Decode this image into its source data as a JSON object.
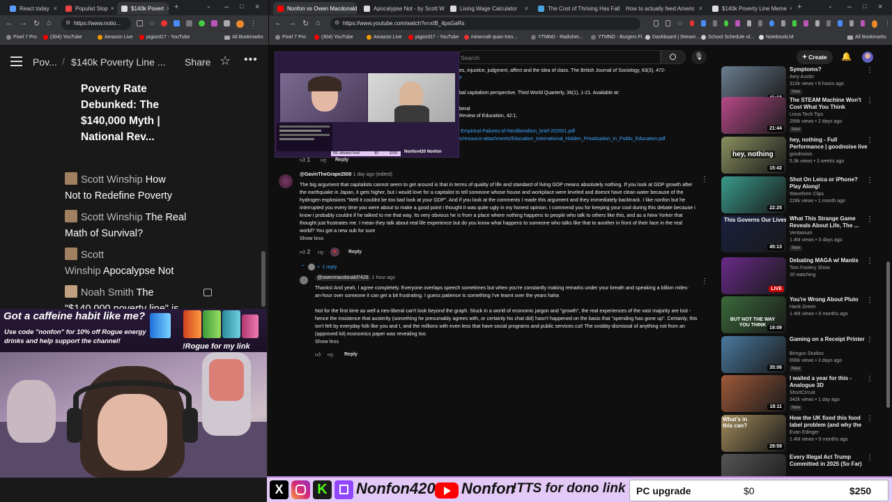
{
  "left_browser": {
    "tabs": [
      {
        "label": "React today",
        "color": "#5a9cff"
      },
      {
        "label": "Populist Slop",
        "color": "#e44"
      },
      {
        "label": "$140k Povert",
        "color": "#ddd"
      }
    ],
    "url": "https://www.notio...",
    "bookmarks": [
      "Pixel 7 Pro",
      "(304) YouTube",
      "Amazon Live",
      "pigiord17 - YouTube"
    ],
    "bookmarks_folder": "All Bookmarks",
    "header": {
      "crumb1": "Pov...",
      "crumb2": "$140k Poverty Line ...",
      "share": "Share"
    },
    "article_title": [
      "Poverty Rate",
      "Debunked: The",
      "$140,000 Myth |",
      "National Rev..."
    ],
    "items": [
      {
        "author": "Scott Winship",
        "title1": "How",
        "title2": "Not to Redefine Poverty"
      },
      {
        "author": "Scott Winship",
        "title1": "The Real",
        "title2": "Math of Survival?"
      },
      {
        "author": "Scott",
        "author2": "Winship",
        "title1": "Apocalypse Not"
      },
      {
        "author": "Noah Smith",
        "title1": "The",
        "title2": "\"$140,000 poverty line\" is"
      }
    ]
  },
  "right_browser": {
    "tabs": [
      {
        "label": "Nonfon vs Owen Macdonald",
        "color": "#f00"
      },
      {
        "label": "Apocalypse Not - by Scott W",
        "color": "#ddd"
      },
      {
        "label": "Living Wage Calculator",
        "color": "#ddd"
      },
      {
        "label": "The Cost of Thriving Has Fall",
        "color": "#4aa3df"
      },
      {
        "label": "How to actually feed Americ",
        "color": "#ddd"
      },
      {
        "label": "$140k Poverty Line Meme",
        "color": "#ddd"
      }
    ],
    "url": "https://www.youtube.com/watch?v=xIB_4psGaRs",
    "bookmarks": [
      "Pixel 7 Pro",
      "(304) YouTube",
      "Amazon Live",
      "pigiord17 - YouTube",
      "minecraft quan tron...",
      "YTMND - Radisher...",
      "YTMND - Burgers Fl...",
      "Dashboard | Stream...",
      "School Schedule of...",
      "NotebookLM"
    ],
    "bookmarks_folder": "All Bookmarks"
  },
  "youtube": {
    "search_placeholder": "Search",
    "create_label": "Create",
    "refs": [
      "es, injustice, judgment, affect and the idea of class. The British Journal of Sociology, 63(3), 472-",
      "bal capitalism perspective. Third World Quarterly, 36(1), 1-21. Available at:",
      "beral",
      "Review of Education, 42:1,",
      "-Empirical-Failures-of-Neoliberalism_brief-202001.pdf",
      "s/resource-attachments/Education_International_Hidden_Privatisation_in_Public_Education.pdf"
    ],
    "top_likes": "1",
    "reply_label": "Reply",
    "comment1": {
      "author": "@GavinTheGrape2500",
      "time": "1 day ago (edited)",
      "text": "The big argument that capitalists cannot seem to get around is that in terms of quality of life and standard of living GDP means absolutely nothing. If you look at GDP growth after the earthquake in Japan, it gets higher, but i would love for a capitalist to tell someone whose house and workplace were leveled and doesnt have clean water because of the hydrogen explosions \"Well it couldnt be too bad look at your GDP\". And if you look at the comments I made this argument and they immediately backtrack. I like nonfon but he interrupted you every time you were about to make a good point i thought it was quite ugly in my honest opinion. I commend you for keeping your cool during this debate because i know i probably couldnt if he talked to me that way. Its very obvious he is from a place where nothing happens to people who talk to others like this, and as a New Yorker that thought just frustrates me. I mean they talk about real life experience but do you know what happens to someone who talks like that to another in front of their face in the real world? You got a new sub for sure",
      "show_less": "Show less",
      "likes": "2",
      "replies": "1 reply"
    },
    "reply1": {
      "author": "@owenmacdonald7428",
      "time": "1 hour ago",
      "text1": "Thanks! And yeah, I agree completely. Everyone overlaps speech sometimes but when you're constantly making remarks under your breath and speaking a billion miles-an-hour over someone it can get a bit frustrating. I guess patience is something I've learnt over the years haha",
      "text2": "Not for the first time as well a neo-liberal can't look beyond the graph. Stuck in a world of economic jargon and \"growth\", the real experiences of the vast majority are lost - hence the insistence that austerity (something he presumably agrees with, or certainly his chat did) hasn't happened on the basis that \"spending has gone up\". Certainly, this isn't felt by everyday folk like you and I, and the millions with even less that have social programs and public services cut! The snobby dismissal of anything not from an (approved lol) economics paper was revealing too.",
      "show_less": "Show less"
    },
    "sidebar": [
      {
        "title": "Symptoms?",
        "channel": "Amy Austin",
        "meta": "310k views • 6 hours ago",
        "new": "New",
        "dur": "41:18",
        "color": "#6a7d8f"
      },
      {
        "title": "The STEAM Machine Won't Cost What You Think",
        "channel": "Linus Tech Tips",
        "meta": "299k views • 2 days ago",
        "new": "New",
        "dur": "21:44",
        "color": "#b84a8a"
      },
      {
        "title": "hey, nothing - Full Performance | goodnoise live",
        "channel": "goodnoise.",
        "meta": "5.3k views • 3 weeks ago",
        "new": "",
        "dur": "15:42",
        "color": "#8a8f60"
      },
      {
        "title": "Shot On Leica or iPhone? Play Along!",
        "channel": "Waveform Clips",
        "meta": "226k views • 1 month ago",
        "new": "",
        "dur": "22:25",
        "color": "#3a9a8a"
      },
      {
        "title": "What This Strange Game Reveals About Life, The ...",
        "channel": "Veritasium",
        "meta": "1.4M views • 3 days ago",
        "new": "New",
        "dur": "45:13",
        "color": "#1a2040"
      },
      {
        "title": "Debating MAGA w/ Mantis",
        "channel": "Tom Foolery Show",
        "meta": "20 watching",
        "new": "",
        "dur": "LIVE",
        "color": "#6a2a8a"
      },
      {
        "title": "You're Wrong About Pluto",
        "channel": "Hank Green",
        "meta": "1.4M views • 9 months ago",
        "new": "",
        "dur": "19:09",
        "color": "#3a6a3a"
      },
      {
        "title": "Gaming on a Receipt Printer",
        "channel": "Bringus Studios",
        "meta": "696k views • 3 days ago",
        "new": "New",
        "dur": "35:06",
        "color": "#4a7aa0"
      },
      {
        "title": "I waited a year for this - Analogue 3D",
        "channel": "ShortCircuit",
        "meta": "342k views • 1 day ago",
        "new": "New",
        "dur": "18:11",
        "color": "#a05a3a"
      },
      {
        "title": "How the UK fixed this food label problem (and why the US hasn't)",
        "channel": "Evan Edinger",
        "meta": "1.4M views • 9 months ago",
        "new": "",
        "dur": "29:59",
        "color": "#a08a5a"
      },
      {
        "title": "Every Illegal Act Trump Committed in 2025 (So Far)",
        "channel": "",
        "meta": "",
        "new": "",
        "dur": "",
        "color": "#555"
      }
    ],
    "thumb_texts": {
      "nothing": "hey, nothing",
      "governs": "This Governs Our Lives",
      "not_way": "BUT NOT THE WAY YOU THINK",
      "whats": "What's in this can?"
    }
  },
  "stream_overlay": {
    "ad_title": "Got a caffeine habit like me?",
    "ad_body": "Use code \"nonfon\" for 10% off Rogue energy drinks and help support the channel!",
    "ad_link": "!Rogue for my link",
    "webcam_bar_label": "IRL debates fund",
    "webcam_bar_left": "$0",
    "webcam_bar_right": "$150",
    "webcam_tag1": "Nonfon420",
    "webcam_tag2": "Nonfon",
    "bottom_handle": "Nonfon420",
    "bottom_handle2": "Nonfon",
    "tts": "!TTS for dono link",
    "goal_label": "PC upgrade",
    "goal_current": "$0",
    "goal_target": "$250",
    "goal_progress": 0
  },
  "colors": {
    "accent": "#3ea6ff",
    "youtube_red": "#ff0000",
    "overlay_bar": "#e3c9f5"
  }
}
